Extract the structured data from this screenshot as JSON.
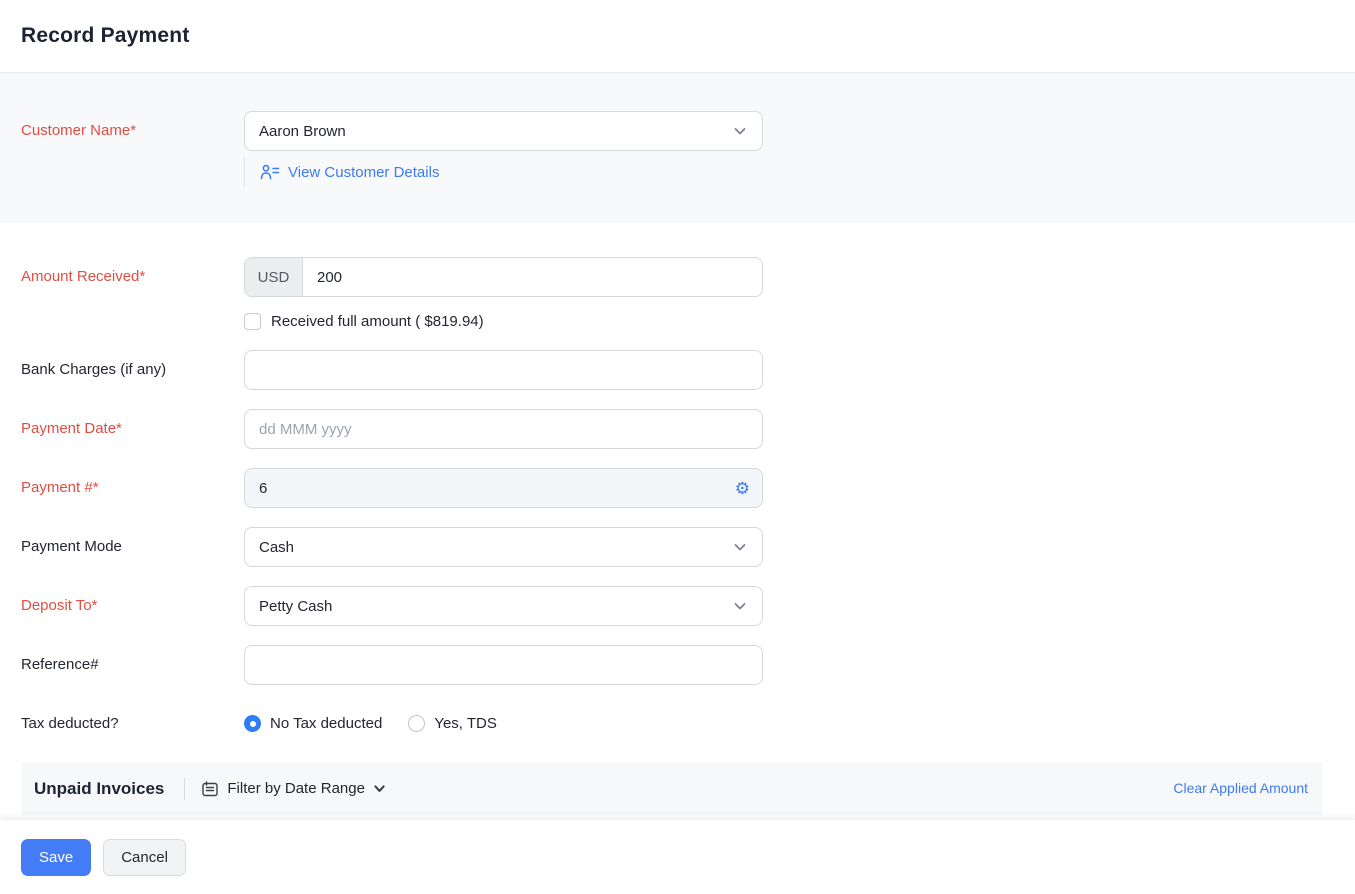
{
  "header": {
    "title": "Record Payment"
  },
  "form": {
    "customer": {
      "label": "Customer Name*",
      "value": "Aaron Brown",
      "view_details_label": "View Customer Details"
    },
    "amount_received": {
      "label": "Amount Received*",
      "currency": "USD",
      "value": "200",
      "full_amount_label": "Received full amount ( $819.94)"
    },
    "bank_charges": {
      "label": "Bank Charges (if any)",
      "value": ""
    },
    "payment_date": {
      "label": "Payment Date*",
      "placeholder": "dd MMM yyyy",
      "value": ""
    },
    "payment_number": {
      "label": "Payment #*",
      "value": "6"
    },
    "payment_mode": {
      "label": "Payment Mode",
      "value": "Cash"
    },
    "deposit_to": {
      "label": "Deposit To*",
      "value": "Petty Cash"
    },
    "reference": {
      "label": "Reference#",
      "value": ""
    },
    "tax_deducted": {
      "label": "Tax deducted?",
      "options": [
        {
          "label": "No Tax deducted",
          "selected": true
        },
        {
          "label": "Yes, TDS",
          "selected": false
        }
      ]
    }
  },
  "unpaid_invoices": {
    "title": "Unpaid Invoices",
    "filter_label": "Filter by Date Range",
    "clear_link_label": "Clear Applied Amount"
  },
  "footer": {
    "save_label": "Save",
    "cancel_label": "Cancel"
  },
  "colors": {
    "accent_blue": "#447cf5",
    "link_blue": "#3e7bf0",
    "required_red": "#e04e43",
    "section_gray": "#f8f9fb",
    "border_gray": "#d5d9de"
  }
}
